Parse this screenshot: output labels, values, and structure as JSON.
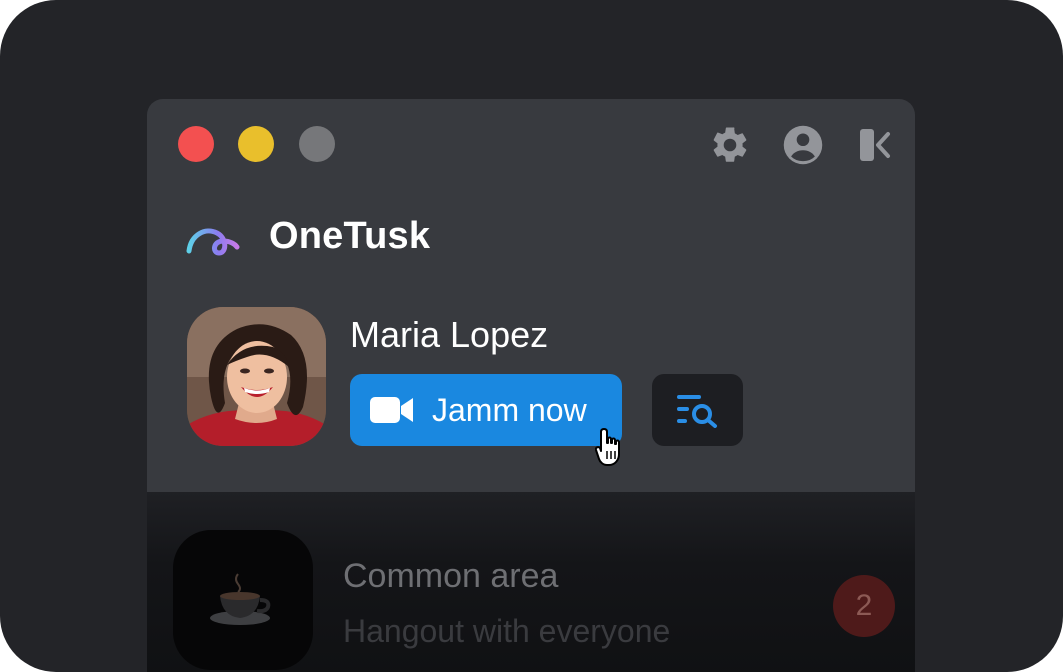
{
  "app": {
    "name": "OneTusk"
  },
  "window_controls": [
    "close",
    "minimize",
    "maximize"
  ],
  "toolbar": {
    "icons": [
      "gear-icon",
      "account-circle-icon",
      "collapse-sidebar-icon"
    ]
  },
  "user": {
    "name": "Maria Lopez",
    "avatar": "portrait photo"
  },
  "actions": {
    "jamm_label": "Jamm now",
    "jamm_icon": "video-camera-icon",
    "secondary_icon": "list-search-icon"
  },
  "room": {
    "name": "Common area",
    "description": "Hangout with everyone",
    "unread_count": "2",
    "icon": "coffee-cup-icon"
  },
  "colors": {
    "accent": "#1a88e0",
    "close": "#f35050",
    "minimize": "#e9bf2c",
    "maximize": "#76777a",
    "badge": "#4e1a1a"
  }
}
